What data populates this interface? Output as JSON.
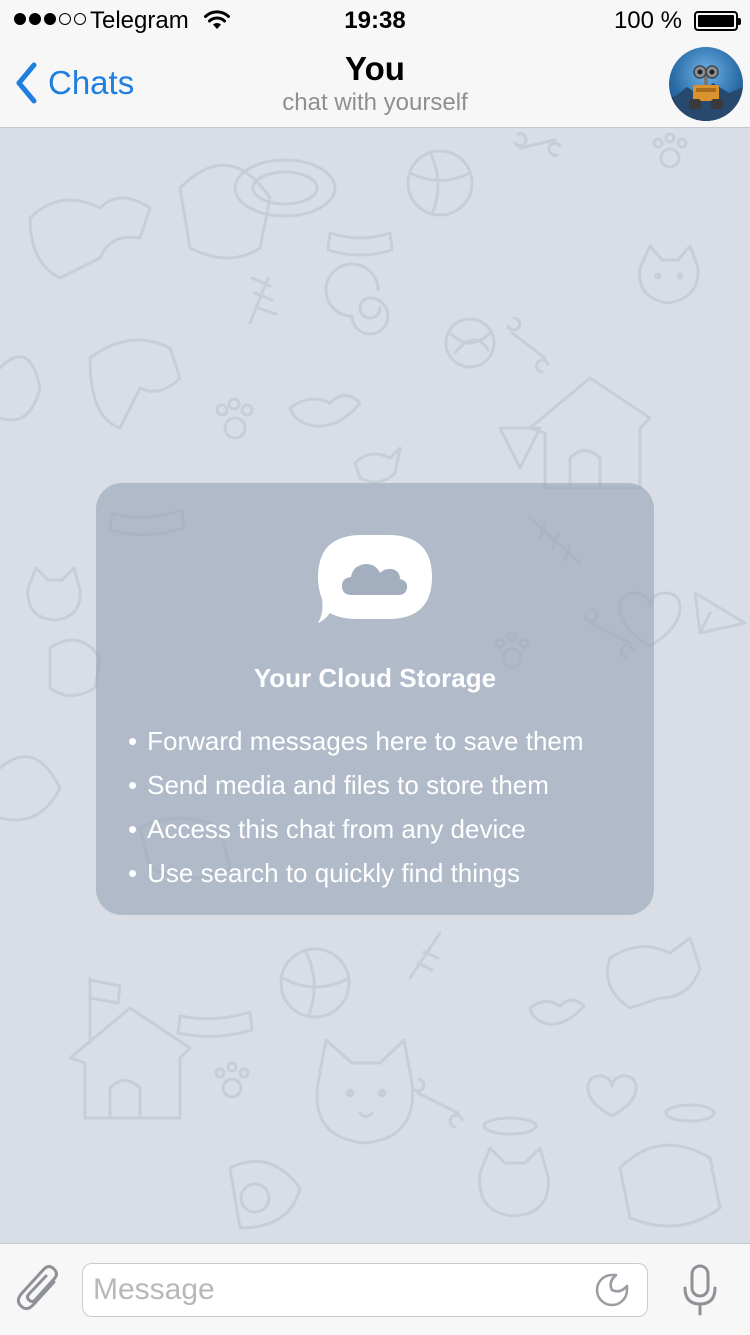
{
  "status_bar": {
    "carrier": "Telegram",
    "time": "19:38",
    "battery": "100 %",
    "battery_level": 1.0,
    "signal_bars": 3,
    "signal_total": 5
  },
  "nav": {
    "back_label": "Chats",
    "title": "You",
    "subtitle": "chat with yourself"
  },
  "cloud_storage": {
    "title": "Your Cloud Storage",
    "items": [
      "Forward messages here to save them",
      "Send media and files to store them",
      "Access this chat from any device",
      "Use search to quickly find things"
    ]
  },
  "input": {
    "placeholder": "Message",
    "value": ""
  },
  "icons": {
    "back": "chevron-left-icon",
    "attach": "paperclip-icon",
    "sticker": "sticker-icon",
    "mic": "microphone-icon",
    "cloud": "cloud-bubble-icon"
  },
  "colors": {
    "accent": "#1f7fe0",
    "chat_background": "#d9dee6",
    "bar_background": "#f7f7f7",
    "card_background": "#a0acbc"
  }
}
